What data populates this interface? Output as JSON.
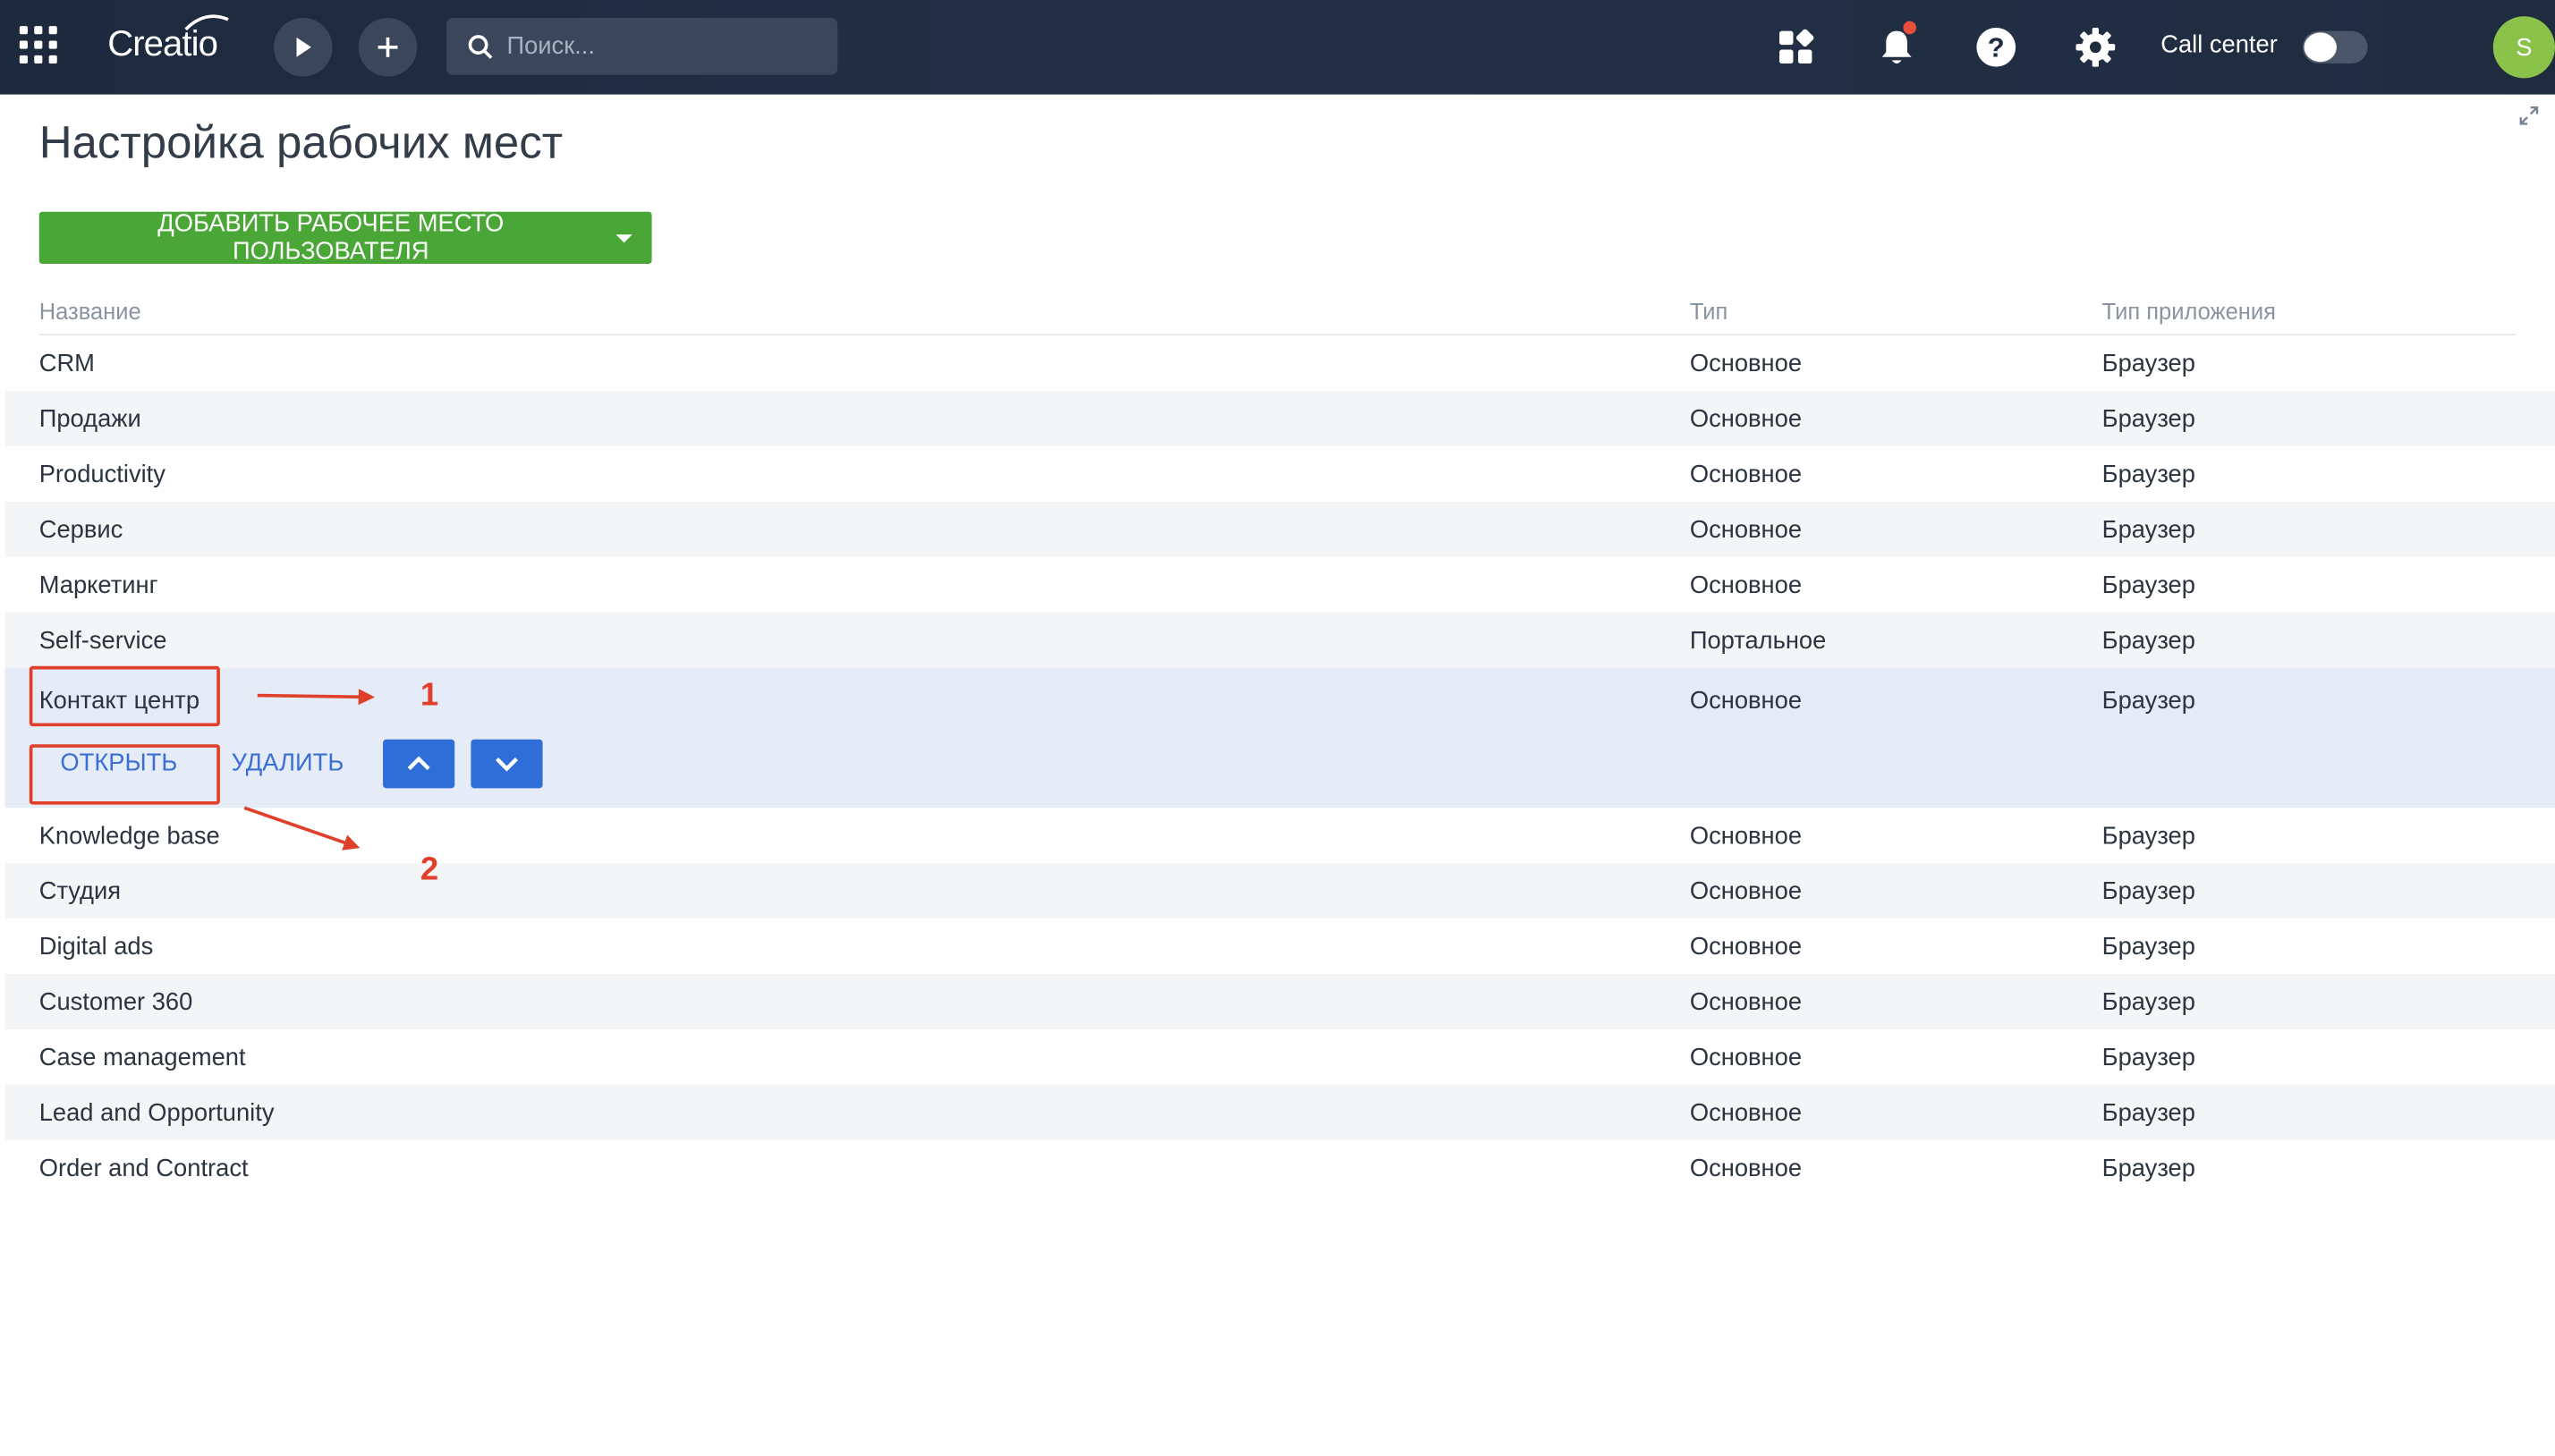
{
  "topbar": {
    "logo_text": "Creatio",
    "search_placeholder": "Поиск...",
    "call_center_label": "Call center",
    "call_center_enabled": false,
    "avatar_letter": "S",
    "notification_indicator": true,
    "icons": [
      "apps-grid-icon",
      "play-icon",
      "plus-icon",
      "search-icon",
      "widgets-icon",
      "bell-icon",
      "help-icon",
      "gear-icon"
    ]
  },
  "page": {
    "title": "Настройка рабочих мест",
    "add_button_label": "ДОБАВИТЬ РАБОЧЕЕ МЕСТО ПОЛЬЗОВАТЕЛЯ"
  },
  "grid": {
    "columns": [
      "Название",
      "Тип",
      "Тип приложения"
    ],
    "rows": [
      {
        "name": "CRM",
        "type": "Основное",
        "app_type": "Браузер"
      },
      {
        "name": "Продажи",
        "type": "Основное",
        "app_type": "Браузер"
      },
      {
        "name": "Productivity",
        "type": "Основное",
        "app_type": "Браузер"
      },
      {
        "name": "Сервис",
        "type": "Основное",
        "app_type": "Браузер"
      },
      {
        "name": "Маркетинг",
        "type": "Основное",
        "app_type": "Браузер"
      },
      {
        "name": "Self-service",
        "type": "Портальное",
        "app_type": "Браузер"
      },
      {
        "name": "Контакт центр",
        "type": "Основное",
        "app_type": "Браузер"
      },
      {
        "name": "Knowledge base",
        "type": "Основное",
        "app_type": "Браузер"
      },
      {
        "name": "Студия",
        "type": "Основное",
        "app_type": "Браузер"
      },
      {
        "name": "Digital ads",
        "type": "Основное",
        "app_type": "Браузер"
      },
      {
        "name": "Customer 360",
        "type": "Основное",
        "app_type": "Браузер"
      },
      {
        "name": "Case management",
        "type": "Основное",
        "app_type": "Браузер"
      },
      {
        "name": "Lead and Opportunity",
        "type": "Основное",
        "app_type": "Браузер"
      },
      {
        "name": "Order and Contract",
        "type": "Основное",
        "app_type": "Браузер"
      }
    ],
    "selected_index": 6,
    "row_actions": {
      "open_label": "ОТКРЫТЬ",
      "delete_label": "УДАЛИТЬ"
    }
  },
  "annotations": {
    "marker_1": "1",
    "marker_2": "2",
    "color": "#e0402b"
  },
  "colors": {
    "topbar": "#1f2c40",
    "add_button": "#4aa637",
    "link": "#3a6fd3",
    "move_button": "#2f6ed8",
    "selected_row": "#e5ebf7",
    "alt_row": "#f4f5f7",
    "avatar": "#8bc34a"
  }
}
